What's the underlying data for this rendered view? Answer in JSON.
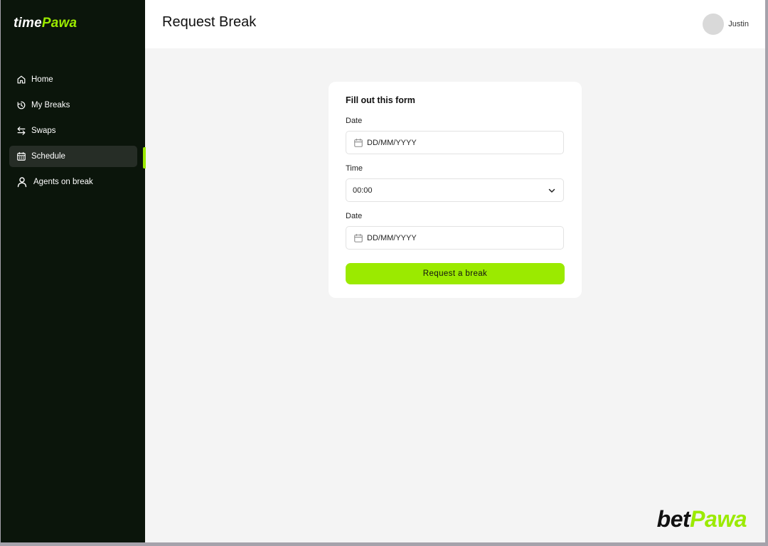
{
  "app": {
    "logo_part1": "time",
    "logo_part2": "Pawa",
    "brand_part1": "bet",
    "brand_part2": "Pawa",
    "accent_color": "#9bea00",
    "sidebar_color": "#0b150b"
  },
  "sidebar": {
    "items": [
      {
        "label": "Home",
        "icon": "home-icon",
        "active": false
      },
      {
        "label": "My Breaks",
        "icon": "timer-icon",
        "active": false
      },
      {
        "label": "Swaps",
        "icon": "swap-arrows-icon",
        "active": false
      },
      {
        "label": "Schedule",
        "icon": "calendar-icon",
        "active": true
      },
      {
        "label": "Agents on break",
        "icon": "person-icon",
        "active": false
      }
    ]
  },
  "header": {
    "title": "Request Break",
    "user_name": "Justin"
  },
  "form": {
    "title": "Fill out this form",
    "date1": {
      "label": "Date",
      "placeholder": "DD/MM/YYYY"
    },
    "time": {
      "label": "Time",
      "value": "00:00"
    },
    "date2": {
      "label": "Date",
      "placeholder": "DD/MM/YYYY"
    },
    "submit_label": "Request a break"
  }
}
